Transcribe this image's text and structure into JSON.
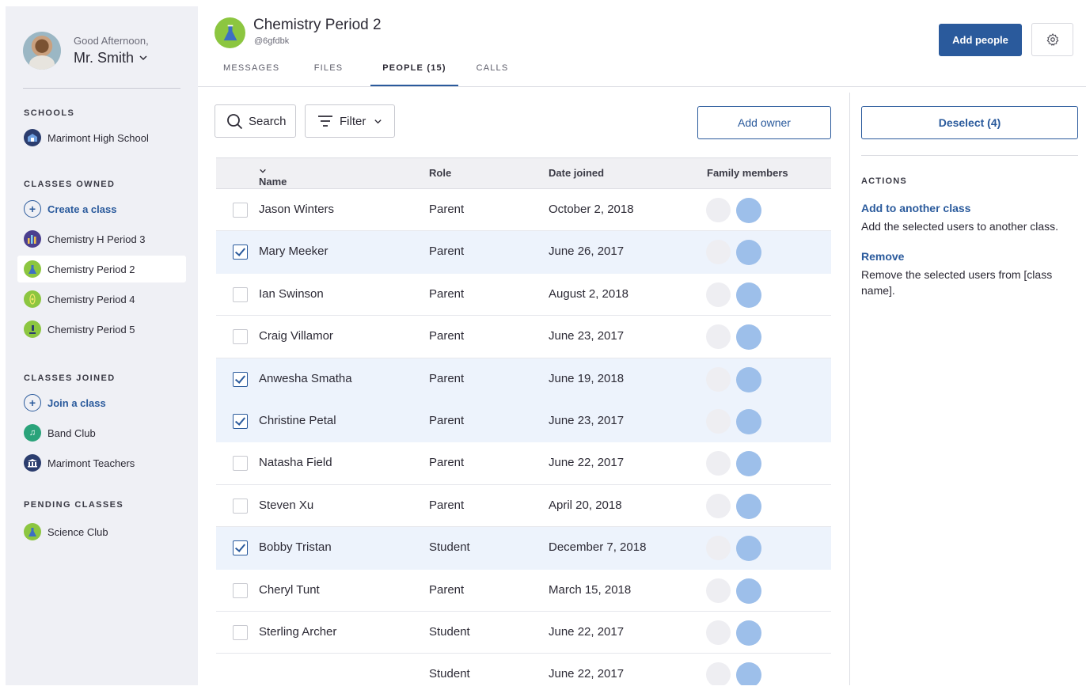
{
  "sidebar": {
    "greeting": "Good Afternoon,",
    "user_name": "Mr. Smith",
    "sections": {
      "schools": "SCHOOLS",
      "owned": "CLASSES OWNED",
      "joined": "CLASSES JOINED",
      "pending": "PENDING CLASSES"
    },
    "schools": [
      {
        "label": "Marimont High School",
        "color": "#2b3d6e"
      }
    ],
    "owned": [
      {
        "label": "Create a class"
      },
      {
        "label": "Chemistry H Period 3",
        "color": "#4b3f8f"
      },
      {
        "label": "Chemistry Period 2",
        "color": "#8cc640"
      },
      {
        "label": "Chemistry Period 4",
        "color": "#8cc640"
      },
      {
        "label": "Chemistry Period 5",
        "color": "#8cc640"
      }
    ],
    "joined": [
      {
        "label": "Join a class"
      },
      {
        "label": "Band Club",
        "color": "#2aa37a"
      },
      {
        "label": "Marimont Teachers",
        "color": "#2b3d6e"
      }
    ],
    "pending": [
      {
        "label": "Science Club",
        "color": "#8cc640"
      }
    ]
  },
  "header": {
    "class_title": "Chemistry Period 2",
    "class_code": "@6gfdbk",
    "tabs": [
      {
        "label": "MESSAGES"
      },
      {
        "label": "FILES"
      },
      {
        "label": "PEOPLE (15)"
      },
      {
        "label": "CALLS"
      }
    ],
    "add_people": "Add people"
  },
  "toolbar": {
    "search": "Search",
    "filter": "Filter",
    "add_owner": "Add owner"
  },
  "table": {
    "columns": {
      "name": "Name",
      "role": "Role",
      "date": "Date joined",
      "family": "Family members"
    },
    "rows": [
      {
        "name": "Jason Winters",
        "role": "Parent",
        "date": "October 2, 2018",
        "checked": false
      },
      {
        "name": "Mary Meeker",
        "role": "Parent",
        "date": "June 26, 2017",
        "checked": true
      },
      {
        "name": "Ian Swinson",
        "role": "Parent",
        "date": "August 2, 2018",
        "checked": false
      },
      {
        "name": "Craig Villamor",
        "role": "Parent",
        "date": "June 23, 2017",
        "checked": false
      },
      {
        "name": "Anwesha Smatha",
        "role": "Parent",
        "date": "June 19, 2018",
        "checked": true
      },
      {
        "name": "Christine Petal",
        "role": "Parent",
        "date": "June 23, 2017",
        "checked": true
      },
      {
        "name": "Natasha Field",
        "role": "Parent",
        "date": "June 22, 2017",
        "checked": false
      },
      {
        "name": "Steven Xu",
        "role": "Parent",
        "date": "April 20, 2018",
        "checked": false
      },
      {
        "name": "Bobby Tristan",
        "role": "Student",
        "date": "December 7, 2018",
        "checked": true
      },
      {
        "name": "Cheryl Tunt",
        "role": "Parent",
        "date": "March 15, 2018",
        "checked": false
      },
      {
        "name": "Sterling Archer",
        "role": "Student",
        "date": "June 22, 2017",
        "checked": false
      },
      {
        "name": "",
        "role": "Student",
        "date": "June 22, 2017",
        "checked": false
      }
    ]
  },
  "panel": {
    "deselect": "Deselect (4)",
    "actions_title": "ACTIONS",
    "add_to_class": "Add to another class",
    "add_to_class_desc": "Add the selected users to another class.",
    "remove": "Remove",
    "remove_desc": "Remove the selected users from [class name]."
  },
  "colors": {
    "accent": "#2a5a9c",
    "selected_row": "#edf3fc",
    "sidebar_bg": "#eff0f5"
  }
}
